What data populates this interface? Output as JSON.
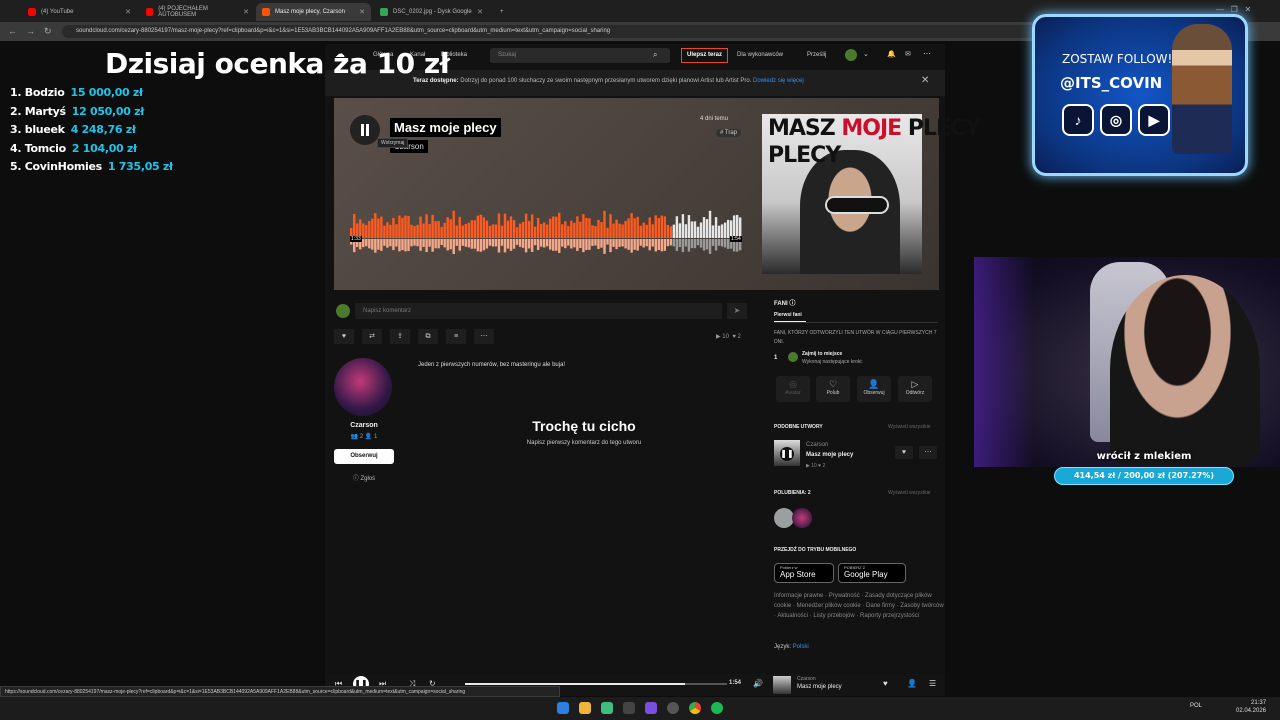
{
  "browser": {
    "tabs": [
      {
        "label": "(4) YouTube",
        "color": "#ff0000"
      },
      {
        "label": "(4) POJECHAŁEM AUTOBUSEM",
        "color": "#ff0000"
      },
      {
        "label": "Masz moje plecy, Czarson",
        "color": "#ff5500"
      },
      {
        "label": "DSC_0202.jpg - Dysk Google",
        "color": "#34a853"
      }
    ],
    "new_tab": "+",
    "url": "soundcloud.com/cezary-880254197/masz-moje-plecy?ref=clipboard&p=i&c=1&si=1E53AB3BCB144092A5A909AFF1A2EB88&utm_source=clipboard&utm_medium=text&utm_campaign=social_sharing"
  },
  "soundcloud": {
    "nav": {
      "home": "Główna",
      "feed": "Kanał",
      "library": "Biblioteka",
      "search_placeholder": "Szukaj",
      "upgrade": "Ulepsz teraz",
      "for_artists": "Dla wykonawców",
      "upload": "Prześlij"
    },
    "banner": {
      "bold": "Teraz dostępne:",
      "text": " Dotrzyj do ponad 100 słuchaczy ze swoim następnym przesłanym utworem dzięki planowi Artist lub Artist Pro. ",
      "link": "Dowiedz się więcej"
    },
    "track": {
      "title": "Masz moje plecy",
      "artist": "Czarson",
      "tooltip": "Wstrzymaj",
      "time_ago": "4 dni temu",
      "tag": "# Trap",
      "elapsed": "1:33",
      "duration": "1:54",
      "progress": 0.82,
      "cover_title_1a": "MASZ ",
      "cover_title_1b": "MOJE",
      "cover_title_1c": " PLECY",
      "cover_title_2": "PLECY"
    },
    "comment": {
      "placeholder": "Napisz komentarz",
      "send": "➤"
    },
    "actions": [
      "♥",
      "⇄",
      "⇪",
      "⧉",
      "≡",
      "⋯"
    ],
    "stats": {
      "plays": "▶ 10",
      "likes": "♥ 2"
    },
    "artist_panel": {
      "name": "Czarson",
      "stats": "👥 2  👤 1",
      "follow": "Obserwuj",
      "report": "ⓘ Zgłoś"
    },
    "description": "Jeden z pierwszych numerów, bez masteringu ale buja!",
    "empty": {
      "title": "Trochę tu cicho",
      "subtitle": "Napisz pierwszy komentarz do tego utworu"
    },
    "sidebar": {
      "fans_header": "FANI",
      "fans_tab": "Pierwsi fani",
      "fans_desc": "FANI, KTÓRZY ODTWORZYLI TEN UTWÓR W CIĄGU PIERWSZYCH 7 DNI.",
      "fan_rank": "1",
      "fan_claim": "Zajmij to miejsce",
      "fan_steps": "Wykonaj następujące kroki:",
      "ctas": [
        {
          "icon": "◎",
          "label": "Awatar"
        },
        {
          "icon": "♡",
          "label": "Polub"
        },
        {
          "icon": "👤",
          "label": "Obserwuj"
        },
        {
          "icon": "▷",
          "label": "Odtwórz"
        }
      ],
      "similar_header": "PODOBNE UTWORY",
      "view_all": "Wyświetl wszystkie",
      "similar_artist": "Czarson",
      "similar_title": "Masz moje plecy",
      "similar_stats": "▶ 10  ♥ 2",
      "likes_header": "POLUBIENIA: 2",
      "mobile_header": "PRZEJDŹ DO TRYBU MOBILNEGO",
      "appstore_small": "Pobierz w",
      "appstore": "App Store",
      "gplay_small": "POBIERZ Z",
      "gplay": "Google Play",
      "footer": "Informacje prawne · Prywatność · Zasady dotyczące plików cookie · Menedżer plików cookie · Dane firmy · Zasoby twórców · Aktualności · Listy przebojów · Raporty przejrzystości",
      "lang_label": "Język: ",
      "lang_value": "Polski"
    },
    "player": {
      "time": "1:54",
      "artist": "Czarson",
      "title": "Masz moje plecy"
    }
  },
  "status_url": "https://soundcloud.com/cezary-880254197/masz-moje-plecy?ref=clipboard&p=i&c=1&si=1E53AB3BCB144092A5A909AFF1A2EB88&utm_source=clipboard&utm_medium=text&utm_campaign=social_sharing",
  "overlay": {
    "headline": "Dzisiaj ocenka za 10 zł",
    "leaderboard": [
      {
        "rank": "1. Bodzio",
        "amount": "15 000,00 zł"
      },
      {
        "rank": "2. Martyś",
        "amount": "12 050,00 zł"
      },
      {
        "rank": "3. blueek",
        "amount": "4 248,76 zł"
      },
      {
        "rank": "4. Tomcio",
        "amount": "2 104,00 zł"
      },
      {
        "rank": "5. CovinHomies",
        "amount": "1 735,05 zł"
      }
    ],
    "follow_text": "ZOSTAW FOLLOW!",
    "handle": "@ITS_COVIN",
    "goal_title": "wrócił z mlekiem",
    "goal_value": "414,54 zł / 200,00 zł (207.27%)",
    "goal_ratio": 2.0727
  },
  "taskbar": {
    "time": "21:37",
    "date": "02.04.2026",
    "lang": "POL"
  }
}
